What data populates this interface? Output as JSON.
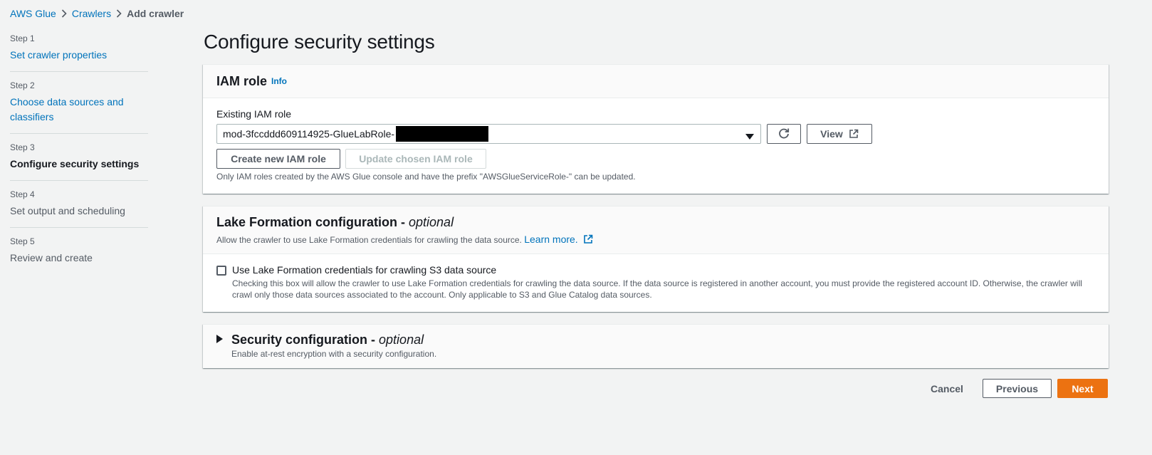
{
  "breadcrumb": {
    "items": [
      "AWS Glue",
      "Crawlers"
    ],
    "current": "Add crawler"
  },
  "steps": [
    {
      "num": "Step 1",
      "label": "Set crawler properties"
    },
    {
      "num": "Step 2",
      "label": "Choose data sources and classifiers"
    },
    {
      "num": "Step 3",
      "label": "Configure security settings"
    },
    {
      "num": "Step 4",
      "label": "Set output and scheduling"
    },
    {
      "num": "Step 5",
      "label": "Review and create"
    }
  ],
  "page_title": "Configure security settings",
  "iam": {
    "title": "IAM role",
    "info": "Info",
    "field_label": "Existing IAM role",
    "selected_value": "mod-3fccddd609114925-GlueLabRole-",
    "view_label": "View",
    "create_label": "Create new IAM role",
    "update_label": "Update chosen IAM role",
    "hint": "Only IAM roles created by the AWS Glue console and have the prefix \"AWSGlueServiceRole-\" can be updated."
  },
  "lake_formation": {
    "title": "Lake Formation configuration - ",
    "optional": "optional",
    "description": "Allow the crawler to use Lake Formation credentials for crawling the data source.",
    "learn_more": "Learn more.",
    "checkbox_label": "Use Lake Formation credentials for crawling S3 data source",
    "checkbox_checked": false,
    "checkbox_description": "Checking this box will allow the crawler to use Lake Formation credentials for crawling the data source. If the data source is registered in another account, you must provide the registered account ID. Otherwise, the crawler will crawl only those data sources associated to the account. Only applicable to S3 and Glue Catalog data sources."
  },
  "security_config": {
    "title": "Security configuration - ",
    "optional": "optional",
    "description": "Enable at-rest encryption with a security configuration."
  },
  "footer": {
    "cancel": "Cancel",
    "previous": "Previous",
    "next": "Next"
  },
  "colors": {
    "link": "#0073bb",
    "primary": "#ec7211",
    "background": "#f2f3f3"
  }
}
